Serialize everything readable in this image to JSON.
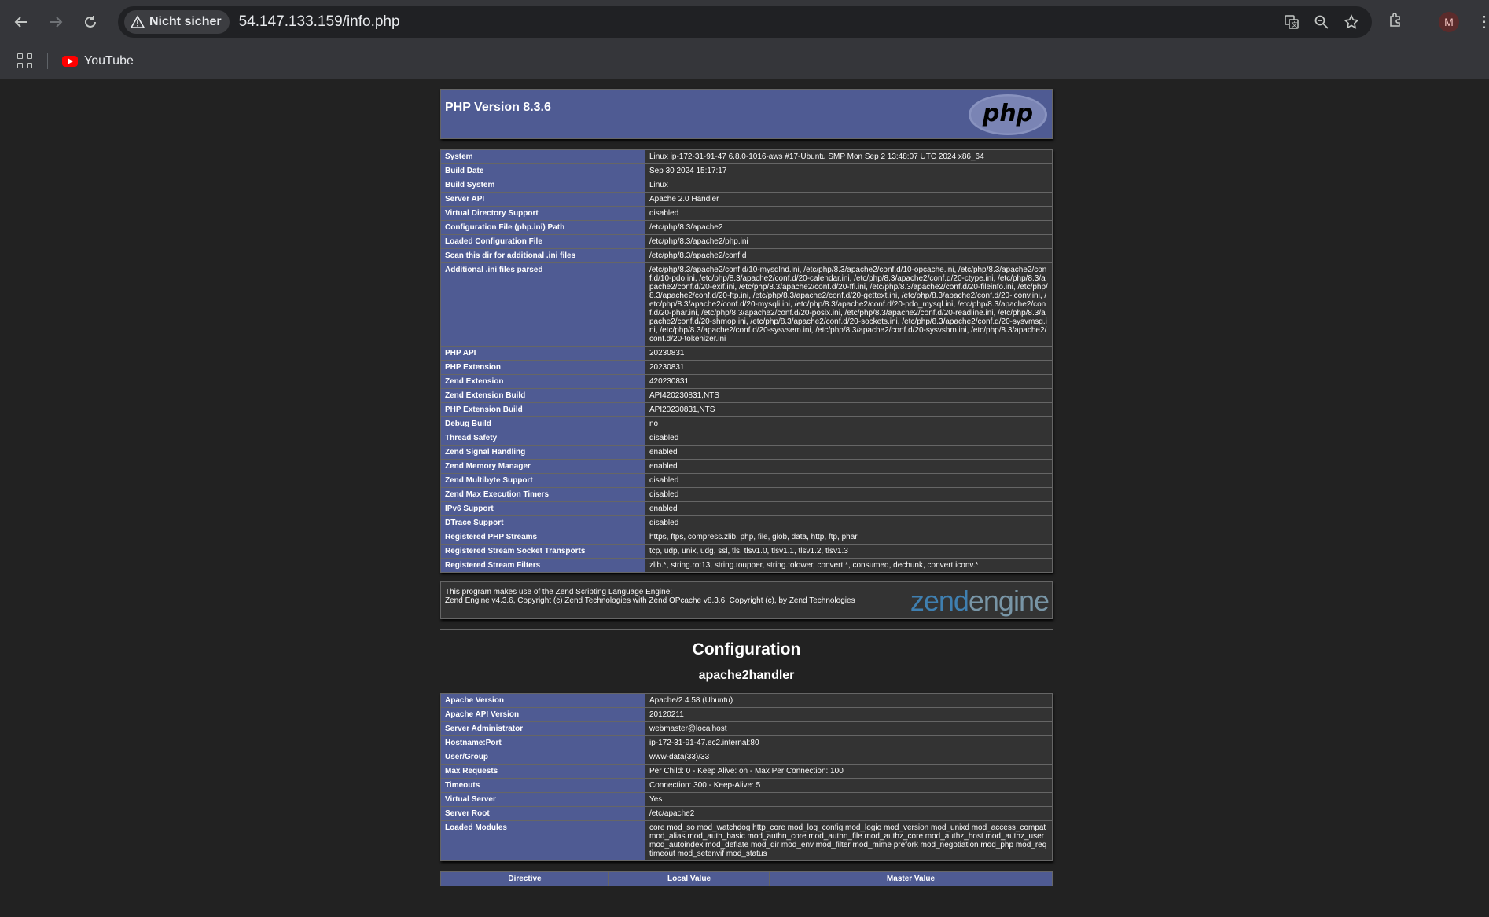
{
  "browser": {
    "security_label": "Nicht sicher",
    "url": "54.147.133.159/info.php",
    "profile_initial": "M",
    "bookmarks": [
      {
        "label": "YouTube"
      }
    ]
  },
  "php": {
    "title": "PHP Version 8.3.6",
    "logo_text": "php",
    "system_rows": [
      {
        "k": "System",
        "v": "Linux ip-172-31-91-47 6.8.0-1016-aws #17-Ubuntu SMP Mon Sep 2 13:48:07 UTC 2024 x86_64"
      },
      {
        "k": "Build Date",
        "v": "Sep 30 2024 15:17:17"
      },
      {
        "k": "Build System",
        "v": "Linux"
      },
      {
        "k": "Server API",
        "v": "Apache 2.0 Handler"
      },
      {
        "k": "Virtual Directory Support",
        "v": "disabled"
      },
      {
        "k": "Configuration File (php.ini) Path",
        "v": "/etc/php/8.3/apache2"
      },
      {
        "k": "Loaded Configuration File",
        "v": "/etc/php/8.3/apache2/php.ini"
      },
      {
        "k": "Scan this dir for additional .ini files",
        "v": "/etc/php/8.3/apache2/conf.d"
      },
      {
        "k": "Additional .ini files parsed",
        "v": "/etc/php/8.3/apache2/conf.d/10-mysqlnd.ini, /etc/php/8.3/apache2/conf.d/10-opcache.ini, /etc/php/8.3/apache2/conf.d/10-pdo.ini, /etc/php/8.3/apache2/conf.d/20-calendar.ini, /etc/php/8.3/apache2/conf.d/20-ctype.ini, /etc/php/8.3/apache2/conf.d/20-exif.ini, /etc/php/8.3/apache2/conf.d/20-ffi.ini, /etc/php/8.3/apache2/conf.d/20-fileinfo.ini, /etc/php/8.3/apache2/conf.d/20-ftp.ini, /etc/php/8.3/apache2/conf.d/20-gettext.ini, /etc/php/8.3/apache2/conf.d/20-iconv.ini, /etc/php/8.3/apache2/conf.d/20-mysqli.ini, /etc/php/8.3/apache2/conf.d/20-pdo_mysql.ini, /etc/php/8.3/apache2/conf.d/20-phar.ini, /etc/php/8.3/apache2/conf.d/20-posix.ini, /etc/php/8.3/apache2/conf.d/20-readline.ini, /etc/php/8.3/apache2/conf.d/20-shmop.ini, /etc/php/8.3/apache2/conf.d/20-sockets.ini, /etc/php/8.3/apache2/conf.d/20-sysvmsg.ini, /etc/php/8.3/apache2/conf.d/20-sysvsem.ini, /etc/php/8.3/apache2/conf.d/20-sysvshm.ini, /etc/php/8.3/apache2/conf.d/20-tokenizer.ini"
      },
      {
        "k": "PHP API",
        "v": "20230831"
      },
      {
        "k": "PHP Extension",
        "v": "20230831"
      },
      {
        "k": "Zend Extension",
        "v": "420230831"
      },
      {
        "k": "Zend Extension Build",
        "v": "API420230831,NTS"
      },
      {
        "k": "PHP Extension Build",
        "v": "API20230831,NTS"
      },
      {
        "k": "Debug Build",
        "v": "no"
      },
      {
        "k": "Thread Safety",
        "v": "disabled"
      },
      {
        "k": "Zend Signal Handling",
        "v": "enabled"
      },
      {
        "k": "Zend Memory Manager",
        "v": "enabled"
      },
      {
        "k": "Zend Multibyte Support",
        "v": "disabled"
      },
      {
        "k": "Zend Max Execution Timers",
        "v": "disabled"
      },
      {
        "k": "IPv6 Support",
        "v": "enabled"
      },
      {
        "k": "DTrace Support",
        "v": "disabled"
      },
      {
        "k": "Registered PHP Streams",
        "v": "https, ftps, compress.zlib, php, file, glob, data, http, ftp, phar"
      },
      {
        "k": "Registered Stream Socket Transports",
        "v": "tcp, udp, unix, udg, ssl, tls, tlsv1.0, tlsv1.1, tlsv1.2, tlsv1.3"
      },
      {
        "k": "Registered Stream Filters",
        "v": "zlib.*, string.rot13, string.toupper, string.tolower, convert.*, consumed, dechunk, convert.iconv.*"
      }
    ],
    "zend_line1": "This program makes use of the Zend Scripting Language Engine:",
    "zend_line2": "Zend Engine v4.3.6, Copyright (c) Zend Technologies with Zend OPcache v8.3.6, Copyright (c), by Zend Technologies",
    "zend_logo_a": "zend",
    "zend_logo_b": "engine",
    "config_heading": "Configuration",
    "module_heading": "apache2handler",
    "apache_rows": [
      {
        "k": "Apache Version",
        "v": "Apache/2.4.58 (Ubuntu)"
      },
      {
        "k": "Apache API Version",
        "v": "20120211"
      },
      {
        "k": "Server Administrator",
        "v": "webmaster@localhost"
      },
      {
        "k": "Hostname:Port",
        "v": "ip-172-31-91-47.ec2.internal:80"
      },
      {
        "k": "User/Group",
        "v": "www-data(33)/33"
      },
      {
        "k": "Max Requests",
        "v": "Per Child: 0 - Keep Alive: on - Max Per Connection: 100"
      },
      {
        "k": "Timeouts",
        "v": "Connection: 300 - Keep-Alive: 5"
      },
      {
        "k": "Virtual Server",
        "v": "Yes"
      },
      {
        "k": "Server Root",
        "v": "/etc/apache2"
      },
      {
        "k": "Loaded Modules",
        "v": "core mod_so mod_watchdog http_core mod_log_config mod_logio mod_version mod_unixd mod_access_compat mod_alias mod_auth_basic mod_authn_core mod_authn_file mod_authz_core mod_authz_host mod_authz_user mod_autoindex mod_deflate mod_dir mod_env mod_filter mod_mime prefork mod_negotiation mod_php mod_reqtimeout mod_setenvif mod_status"
      }
    ],
    "directive_headers": [
      "Directive",
      "Local Value",
      "Master Value"
    ]
  }
}
